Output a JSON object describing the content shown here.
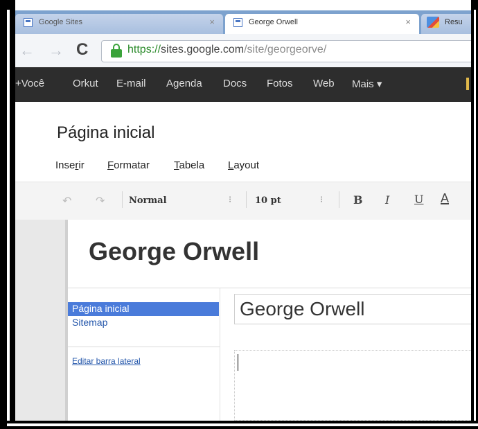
{
  "browser": {
    "tabs": [
      {
        "label": "Google Sites",
        "active": false
      },
      {
        "label": "George Orwell",
        "active": true
      },
      {
        "label": "Resu",
        "active": false
      }
    ],
    "url": {
      "scheme": "https://",
      "host": "sites.google.com",
      "path": "/site/georgeorve/"
    }
  },
  "google_bar": {
    "items": [
      "+Você",
      "Orkut",
      "E-mail",
      "Agenda",
      "Docs",
      "Fotos",
      "Web",
      "Mais ▾"
    ]
  },
  "editor": {
    "page_title": "Página inicial",
    "menu": [
      {
        "pre": "Inse",
        "u": "r",
        "post": "ir"
      },
      {
        "pre": "",
        "u": "F",
        "post": "ormatar"
      },
      {
        "pre": "",
        "u": "T",
        "post": "abela"
      },
      {
        "pre": "",
        "u": "L",
        "post": "ayout"
      }
    ],
    "toolbar": {
      "style": "Normal",
      "size": "10 pt",
      "bold": "B",
      "italic": "I",
      "underline": "U",
      "text_color": "A"
    }
  },
  "site": {
    "title": "George Orwell",
    "sidebar": {
      "items": [
        "Página inicial",
        "Sitemap"
      ],
      "edit_link": "Editar barra lateral"
    },
    "page_heading": "George Orwell"
  },
  "colors": {
    "tabstrip": "#7da2ce",
    "google_bar": "#2d2d2d",
    "nav_selected": "#4a7bda",
    "link": "#2255aa"
  }
}
